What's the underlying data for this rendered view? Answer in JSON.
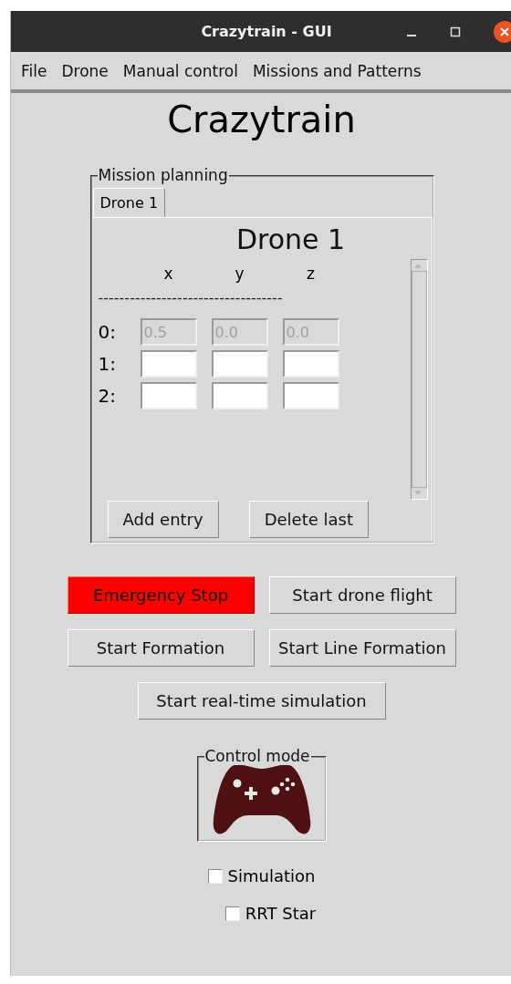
{
  "window": {
    "title": "Crazytrain - GUI"
  },
  "menu": [
    "File",
    "Drone",
    "Manual control",
    "Missions and Patterns"
  ],
  "heading": "Crazytrain",
  "mission_planning": {
    "title": "Mission planning",
    "tabs": [
      {
        "label": "Drone 1",
        "selected": true
      }
    ],
    "panel_title": "Drone 1",
    "columns": [
      "x",
      "y",
      "z"
    ],
    "separator": "-----------------------------------",
    "rows": [
      {
        "label": "0:",
        "cells": [
          {
            "value": "0.5",
            "disabled": true
          },
          {
            "value": "0.0",
            "disabled": true
          },
          {
            "value": "0.0",
            "disabled": true
          }
        ]
      },
      {
        "label": "1:",
        "cells": [
          {
            "disabled": false
          },
          {
            "disabled": false
          },
          {
            "disabled": false
          }
        ]
      },
      {
        "label": "2:",
        "cells": [
          {
            "disabled": false
          },
          {
            "disabled": false
          },
          {
            "disabled": false
          }
        ]
      }
    ],
    "buttons": [
      "Add entry",
      "Delete last"
    ]
  },
  "actions": [
    [
      {
        "label": "Emergency Stop",
        "kind": "emergency"
      },
      {
        "label": "Start drone flight",
        "kind": "normal"
      }
    ],
    [
      {
        "label": "Start Formation",
        "kind": "normal"
      },
      {
        "label": "Start Line Formation",
        "kind": "normal"
      }
    ],
    [
      {
        "label": "Start real-time simulation",
        "kind": "normal"
      }
    ]
  ],
  "control_mode": {
    "title": "Control mode"
  },
  "options": [
    {
      "label": "Simulation",
      "checked": false
    },
    {
      "label": "RRT Star",
      "checked": false
    }
  ]
}
